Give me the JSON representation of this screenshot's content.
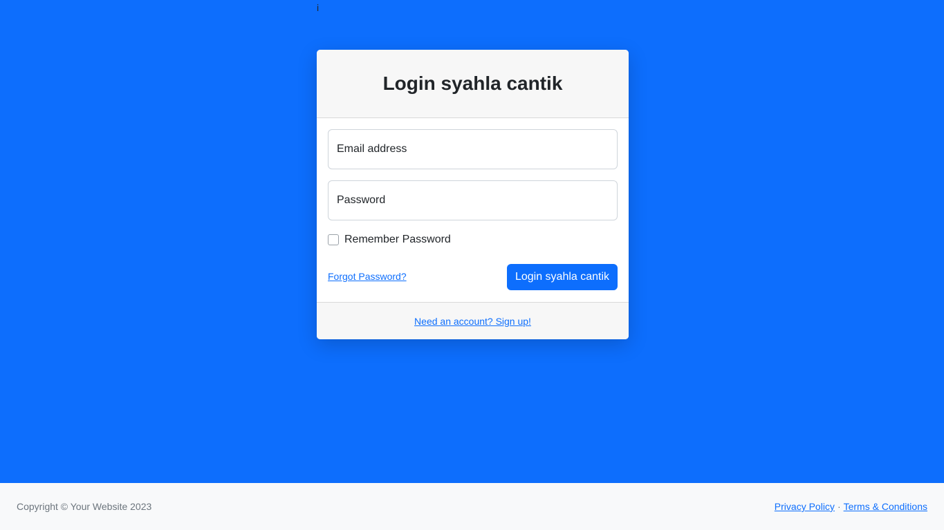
{
  "stray_text": "i",
  "login_card": {
    "title": "Login syahla cantik",
    "email_field": {
      "label": "Email address",
      "value": ""
    },
    "password_field": {
      "label": "Password",
      "value": ""
    },
    "remember_label": "Remember Password",
    "remember_checked": false,
    "forgot_link": "Forgot Password?",
    "login_button": "Login syahla cantik",
    "signup_link": "Need an account? Sign up!"
  },
  "footer": {
    "copyright": "Copyright © Your Website 2023",
    "privacy_link": "Privacy Policy",
    "separator": "·",
    "terms_link": "Terms & Conditions"
  },
  "colors": {
    "background": "#0d6efd",
    "primary": "#0d6efd",
    "card_header": "#f7f7f7",
    "footer_bg": "#f8f9fa"
  }
}
